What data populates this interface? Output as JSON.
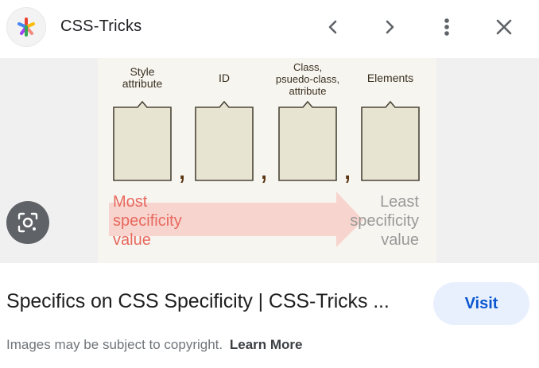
{
  "header": {
    "site_name": "CSS-Tricks",
    "logo_icon": "asterisk-logo-icon",
    "buttons": {
      "prev_icon": "chevron-left-icon",
      "next_icon": "chevron-right-icon",
      "more_icon": "more-vert-icon",
      "close_icon": "close-icon"
    }
  },
  "image_preview": {
    "columns": [
      {
        "label_lines": [
          "Style",
          "attribute"
        ]
      },
      {
        "label_lines": [
          "ID"
        ]
      },
      {
        "label_lines": [
          "Class,",
          "psuedo-class,",
          "attribute"
        ]
      },
      {
        "label_lines": [
          "Elements"
        ]
      }
    ],
    "separator": ",",
    "most_lines": [
      "Most",
      "specificity",
      "value"
    ],
    "least_lines": [
      "Least",
      "specificity",
      "value"
    ],
    "colors": {
      "most": "#e8685e",
      "least": "#9a9a9a",
      "arrow": "#f7c9c3",
      "comma": "#5a3512",
      "box_fill": "#e8e4d2"
    }
  },
  "lens_icon": "google-lens-icon",
  "result": {
    "title": "Specifics on CSS Specificity | CSS-Tricks ...",
    "visit_label": "Visit"
  },
  "copyright": {
    "text": "Images may be subject to copyright.",
    "link": "Learn More"
  }
}
